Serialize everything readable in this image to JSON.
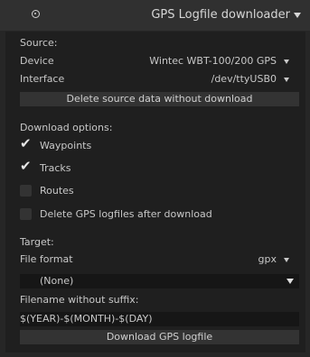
{
  "header": {
    "title": "GPS Logfile downloader",
    "reset_icon": "reset-icon",
    "collapse_icon": "triangle-down-icon"
  },
  "source": {
    "heading": "Source:",
    "device_label": "Device",
    "device_value": "Wintec WBT-100/200 GPS",
    "interface_label": "Interface",
    "interface_value": "/dev/ttyUSB0",
    "delete_button": "Delete source data without download"
  },
  "download_options": {
    "heading": "Download options:",
    "items": [
      {
        "label": "Waypoints",
        "checked": true
      },
      {
        "label": "Tracks",
        "checked": true
      },
      {
        "label": "Routes",
        "checked": false
      },
      {
        "label": "Delete GPS logfiles after download",
        "checked": false
      }
    ]
  },
  "target": {
    "heading": "Target:",
    "file_format_label": "File format",
    "file_format_value": "gpx",
    "select_value": "(None)",
    "filename_label": "Filename without suffix:",
    "filename_value": "$(YEAR)-$(MONTH)-$(DAY)",
    "download_button": "Download GPS logfile"
  },
  "colors": {
    "background": "#262626",
    "panel": "#1f1f1f",
    "button": "#333333",
    "text": "#c8c8c8"
  }
}
